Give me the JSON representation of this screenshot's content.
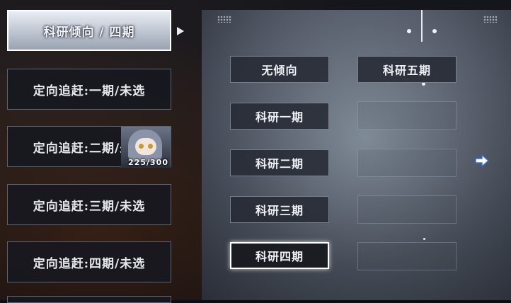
{
  "left_menu": {
    "items": [
      {
        "label": "科研倾向 / 四期",
        "active": true
      },
      {
        "label": "定向追赶:一期/未选"
      },
      {
        "label": "定向追赶:二期/未选"
      },
      {
        "label": "定向追赶:三期/未选"
      },
      {
        "label": "定向追赶:四期/未选"
      }
    ],
    "character_progress": "225/300"
  },
  "tiers": {
    "options": [
      "无倾向",
      "科研五期",
      "科研一期",
      "科研二期",
      "科研三期",
      "科研四期"
    ],
    "selected": "科研四期"
  },
  "icons": {
    "caret": "triangle-right-icon",
    "next": "arrow-right-icon"
  },
  "colors": {
    "accent_border": "#ffffff",
    "button_bg": "#262a34"
  }
}
